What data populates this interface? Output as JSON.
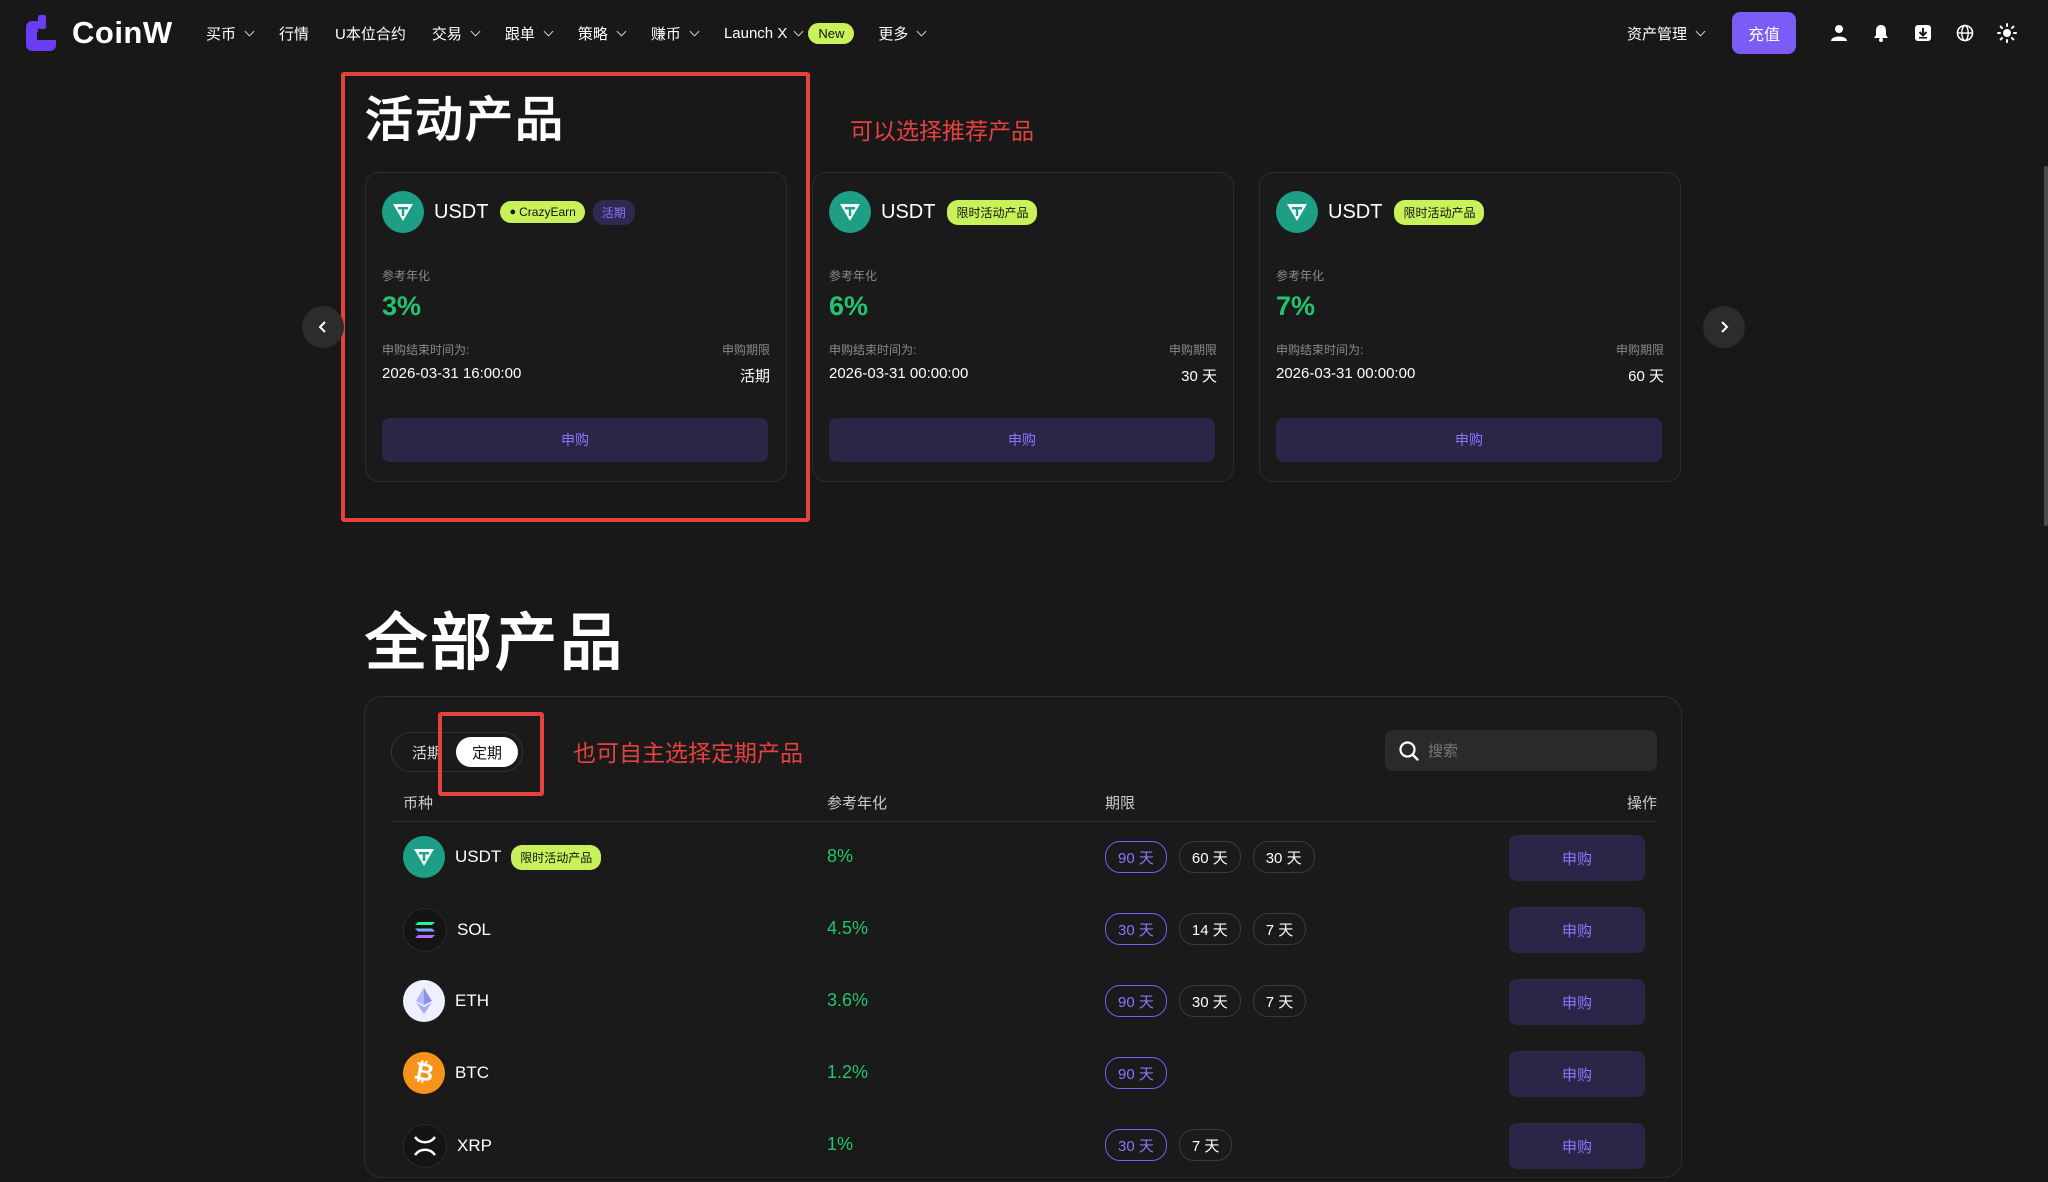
{
  "nav": {
    "logo": "CoinW",
    "menu": [
      {
        "label": "买币",
        "dropdown": true
      },
      {
        "label": "行情",
        "dropdown": false
      },
      {
        "label": "U本位合约",
        "dropdown": false
      },
      {
        "label": "交易",
        "dropdown": true
      },
      {
        "label": "跟单",
        "dropdown": true
      },
      {
        "label": "策略",
        "dropdown": true
      },
      {
        "label": "赚币",
        "dropdown": true
      },
      {
        "label": "Launch X",
        "dropdown": true
      },
      {
        "label": "更多",
        "dropdown": true
      }
    ],
    "new_badge": "New",
    "asset_mgmt": "资产管理",
    "deposit": "充值",
    "icons": [
      "user-icon",
      "bell-icon",
      "download-icon",
      "globe-icon",
      "theme-sun-icon"
    ]
  },
  "featured": {
    "title": "活动产品",
    "annotation": "可以选择推荐产品",
    "cards": [
      {
        "coin": "USDT",
        "tag": "CrazyEarn",
        "tag2": "活期",
        "rate_label": "参考年化",
        "rate": "3%",
        "end_label": "申购结束时间为:",
        "end": "2026-03-31 16:00:00",
        "term_label": "申购期限",
        "term": "活期",
        "button": "申购"
      },
      {
        "coin": "USDT",
        "tag": "限时活动产品",
        "rate_label": "参考年化",
        "rate": "6%",
        "end_label": "申购结束时间为:",
        "end": "2026-03-31 00:00:00",
        "term_label": "申购期限",
        "term": "30 天",
        "button": "申购"
      },
      {
        "coin": "USDT",
        "tag": "限时活动产品",
        "rate_label": "参考年化",
        "rate": "7%",
        "end_label": "申购结束时间为:",
        "end": "2026-03-31 00:00:00",
        "term_label": "申购期限",
        "term": "60 天",
        "button": "申购"
      }
    ]
  },
  "all": {
    "title": "全部产品",
    "annotation": "也可自主选择定期产品",
    "tabs": [
      "活期",
      "定期"
    ],
    "active_tab": "定期",
    "search_placeholder": "搜索",
    "columns": [
      "币种",
      "参考年化",
      "期限",
      "操作"
    ],
    "rows": [
      {
        "coin": "USDT",
        "tag": "限时活动产品",
        "rate": "8%",
        "terms": [
          "90 天",
          "60 天",
          "30 天"
        ],
        "button": "申购",
        "color": "#1e9e85"
      },
      {
        "coin": "SOL",
        "tag": "",
        "rate": "4.5%",
        "terms": [
          "30 天",
          "14 天",
          "7 天"
        ],
        "button": "申购",
        "color": "#141414"
      },
      {
        "coin": "ETH",
        "tag": "",
        "rate": "3.6%",
        "terms": [
          "90 天",
          "30 天",
          "7 天"
        ],
        "button": "申购",
        "color": "#eef0ff"
      },
      {
        "coin": "BTC",
        "tag": "",
        "rate": "1.2%",
        "terms": [
          "90 天"
        ],
        "button": "申购",
        "color": "#f7931a"
      },
      {
        "coin": "XRP",
        "tag": "",
        "rate": "1%",
        "terms": [
          "30 天",
          "7 天"
        ],
        "button": "申购",
        "color": "#141414"
      }
    ]
  },
  "colors": {
    "accent": "#7b5cf5",
    "green": "#22c56d",
    "lime": "#c9f25a",
    "annotation": "#e5413e"
  }
}
